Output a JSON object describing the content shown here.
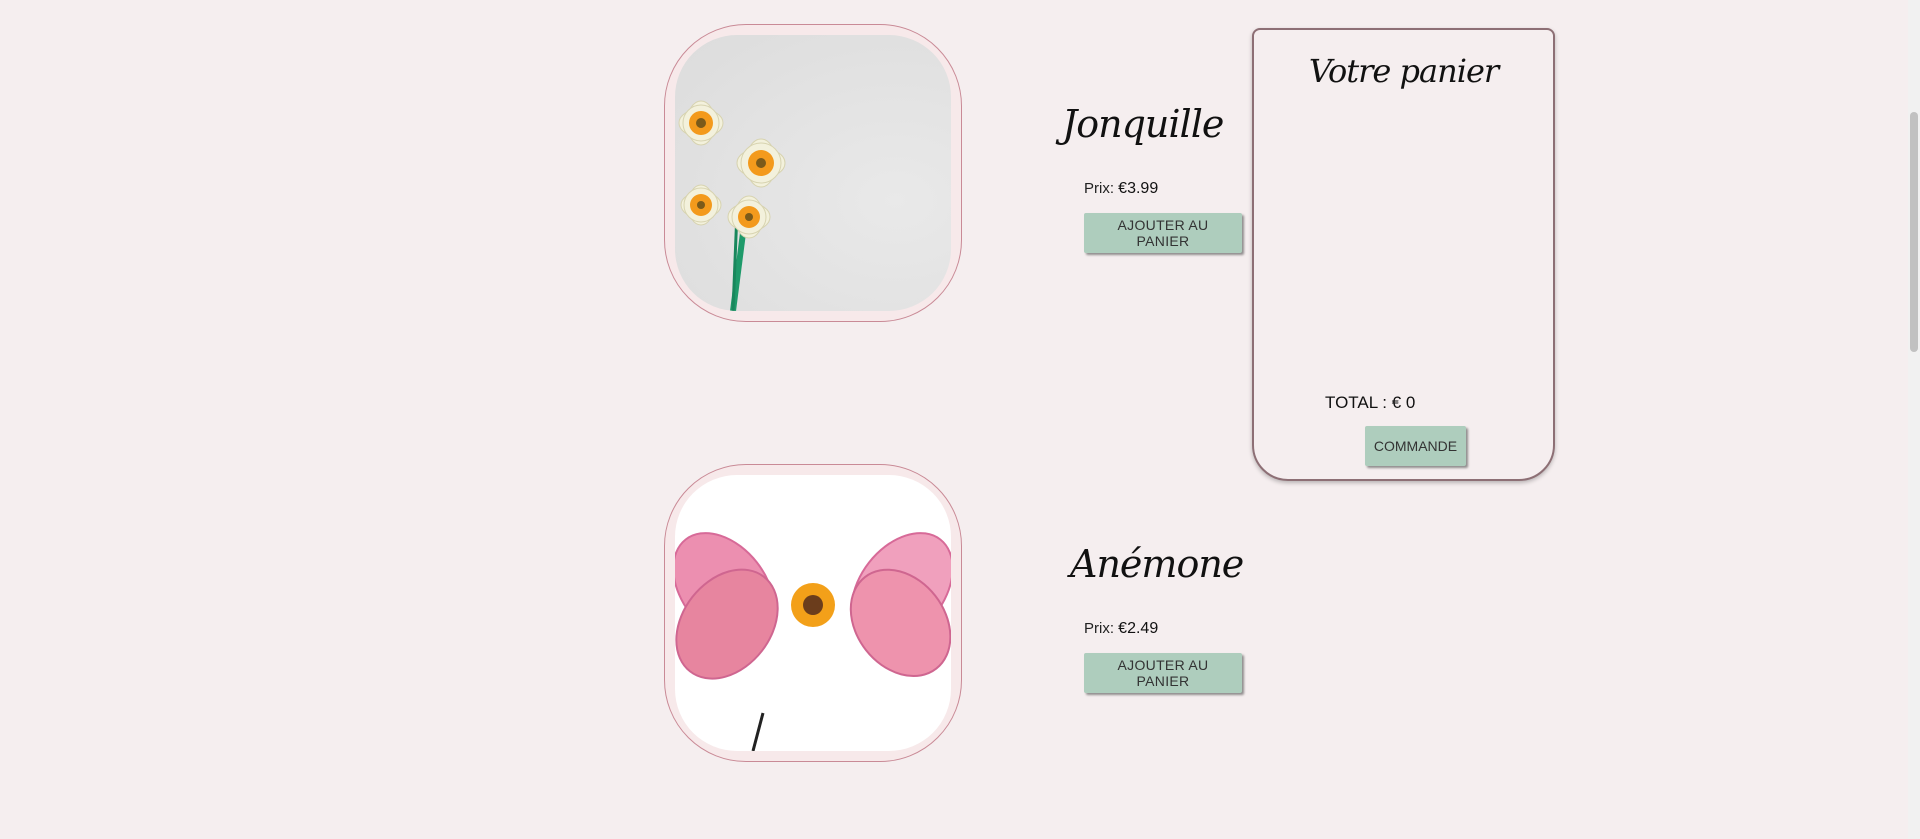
{
  "products": [
    {
      "name": "Jonquille",
      "price_label": "Prix:",
      "price": "€3.99",
      "button_label": "AJOUTER AU PANIER",
      "image_icon": "daffodil-image"
    },
    {
      "name": "Anémone",
      "price_label": "Prix:",
      "price": "€2.49",
      "button_label": "AJOUTER AU PANIER",
      "image_icon": "anemone-image"
    }
  ],
  "cart": {
    "title": "Votre panier",
    "total": "TOTAL : € 0",
    "order_label": "COMMANDE"
  },
  "colors": {
    "background": "#f5eeef",
    "button": "#aecdbd",
    "frame_border": "#c98a96",
    "cart_border": "#8d6f75"
  }
}
